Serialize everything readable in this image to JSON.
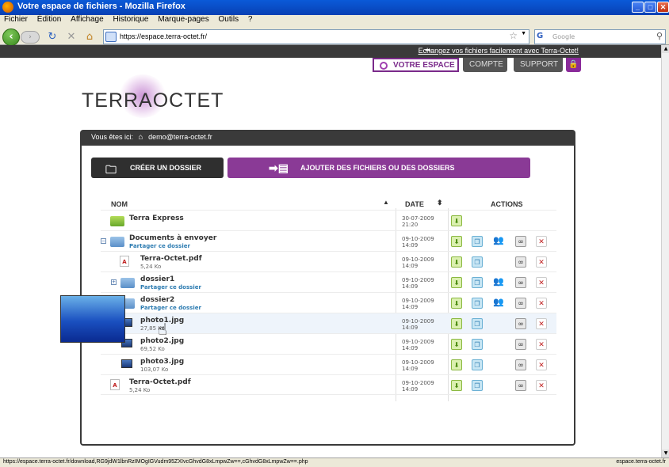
{
  "window": {
    "title": "Votre espace de fichiers - Mozilla Firefox",
    "min": "_",
    "max": "□",
    "close": "✕"
  },
  "menu": [
    "Fichier",
    "Édition",
    "Affichage",
    "Historique",
    "Marque-pages",
    "Outils",
    "?"
  ],
  "nav": {
    "url": "https://espace.terra-octet.fr/",
    "search_placeholder": "Google",
    "back": "‹",
    "forward": "›",
    "star": "☆"
  },
  "site": {
    "top_link": "Echangez vos fichiers facilement avec Terra-Octet!",
    "top_arrow": "➡",
    "tabs": {
      "active": "VOTRE ESPACE",
      "account": "COMPTE",
      "support": "SUPPORT",
      "lock": "🔒"
    },
    "logo": "TERRAOCTET",
    "breadcrumb_prefix": "Vous êtes ici:",
    "breadcrumb_user": "demo@terra-octet.fr",
    "create_folder": "CRÉER UN DOSSIER",
    "add_files": "AJOUTER DES FICHIERS OU DES DOSSIERS",
    "columns": {
      "name": "NOM",
      "date": "DATE",
      "actions": "ACTIONS",
      "sort_up": "▲",
      "sort_both": "⬍"
    },
    "share_label": "Partager ce dossier"
  },
  "rows": [
    {
      "name": "Terra Express",
      "size": "",
      "date": "30-07-2009",
      "time": "21:20",
      "type": "express"
    },
    {
      "name": "Documents à envoyer",
      "size": "",
      "date": "09-10-2009",
      "time": "14:09",
      "type": "folder",
      "expander": "−"
    },
    {
      "name": "Terra-Octet.pdf",
      "size": "5,24 Ko",
      "date": "09-10-2009",
      "time": "14:09",
      "type": "pdf"
    },
    {
      "name": "dossier1",
      "size": "",
      "date": "09-10-2009",
      "time": "14:09",
      "type": "folder",
      "expander": "+"
    },
    {
      "name": "dossier2",
      "size": "",
      "date": "09-10-2009",
      "time": "14:09",
      "type": "folder"
    },
    {
      "name": "photo1.jpg",
      "size": "27,85 Ko",
      "date": "09-10-2009",
      "time": "14:09",
      "type": "img"
    },
    {
      "name": "photo2.jpg",
      "size": "69,52 Ko",
      "date": "09-10-2009",
      "time": "14:09",
      "type": "img"
    },
    {
      "name": "photo3.jpg",
      "size": "103,07 Ko",
      "date": "09-10-2009",
      "time": "14:09",
      "type": "img"
    },
    {
      "name": "Terra-Octet.pdf",
      "size": "5,24 Ko",
      "date": "09-10-2009",
      "time": "14:09",
      "type": "pdf"
    }
  ],
  "status": {
    "left": "https://espace.terra-octet.fr/download,RG9jdW1lbnRzIMOgIGVudm95ZXIvcGhvdG8xLmpwZw==,cGhvdG8xLmpwZw==.php",
    "right": "espace.terra-octet.fr"
  },
  "colors": {
    "accent": "#8a3a96",
    "dark": "#3a3a3a"
  }
}
